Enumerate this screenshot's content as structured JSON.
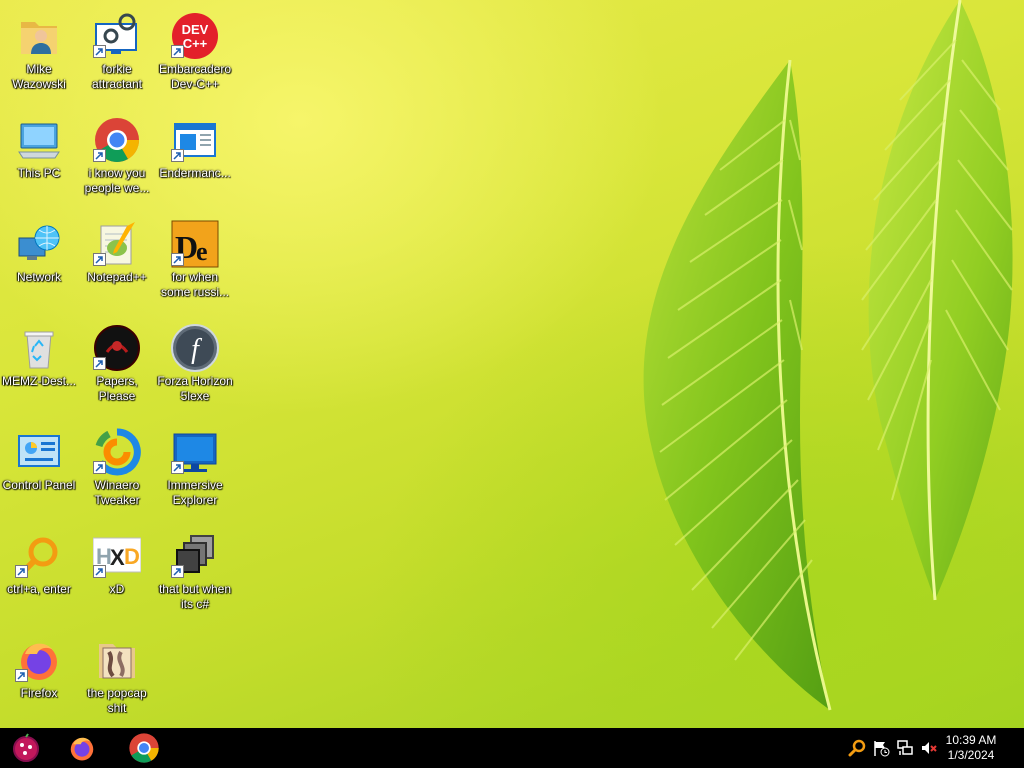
{
  "desktop": {
    "icons": [
      {
        "label": "Mike Wazowski",
        "icon": "user-folder-icon"
      },
      {
        "label": "forkie attractant",
        "icon": "gear-monitor-icon"
      },
      {
        "label": "Embarcadero Dev-C++",
        "icon": "devcpp-icon"
      },
      {
        "label": "This PC",
        "icon": "computer-icon"
      },
      {
        "label": "i know you people we...",
        "icon": "chrome-icon"
      },
      {
        "label": "Endermanc...",
        "icon": "window-app-icon"
      },
      {
        "label": "Network",
        "icon": "network-globe-icon"
      },
      {
        "label": "Notepad++",
        "icon": "notepadpp-icon"
      },
      {
        "label": "for when some russi...",
        "icon": "de-app-icon"
      },
      {
        "label": "MEMZ-Dest...",
        "icon": "recycle-bin-icon"
      },
      {
        "label": "Papers, Please",
        "icon": "papers-please-icon"
      },
      {
        "label": "Forza Horizon 5lexe",
        "icon": "flash-icon"
      },
      {
        "label": "Control Panel",
        "icon": "control-panel-icon"
      },
      {
        "label": "Winaero Tweaker",
        "icon": "winaero-icon"
      },
      {
        "label": "Immersive Explorer",
        "icon": "blue-monitor-icon"
      },
      {
        "label": "ctrl+a, enter",
        "icon": "magnifier-icon"
      },
      {
        "label": "xD",
        "icon": "hxd-icon"
      },
      {
        "label": "that but when its c#",
        "icon": "stacked-windows-icon"
      },
      {
        "label": "Firefox",
        "icon": "firefox-icon"
      },
      {
        "label": "the popcap shit",
        "icon": "popcap-folder-icon"
      }
    ]
  },
  "taskbar": {
    "start_icon": "start-orb-icon",
    "pinned": [
      {
        "name": "Firefox",
        "icon": "firefox-icon"
      },
      {
        "name": "Google Chrome",
        "icon": "chrome-icon"
      }
    ],
    "tray": [
      {
        "icon": "magnifier-tray-icon"
      },
      {
        "icon": "action-center-flag-icon"
      },
      {
        "icon": "network-tray-icon"
      },
      {
        "icon": "speaker-muted-icon"
      }
    ],
    "clock": {
      "time": "10:39 AM",
      "date": "1/3/2024"
    }
  }
}
